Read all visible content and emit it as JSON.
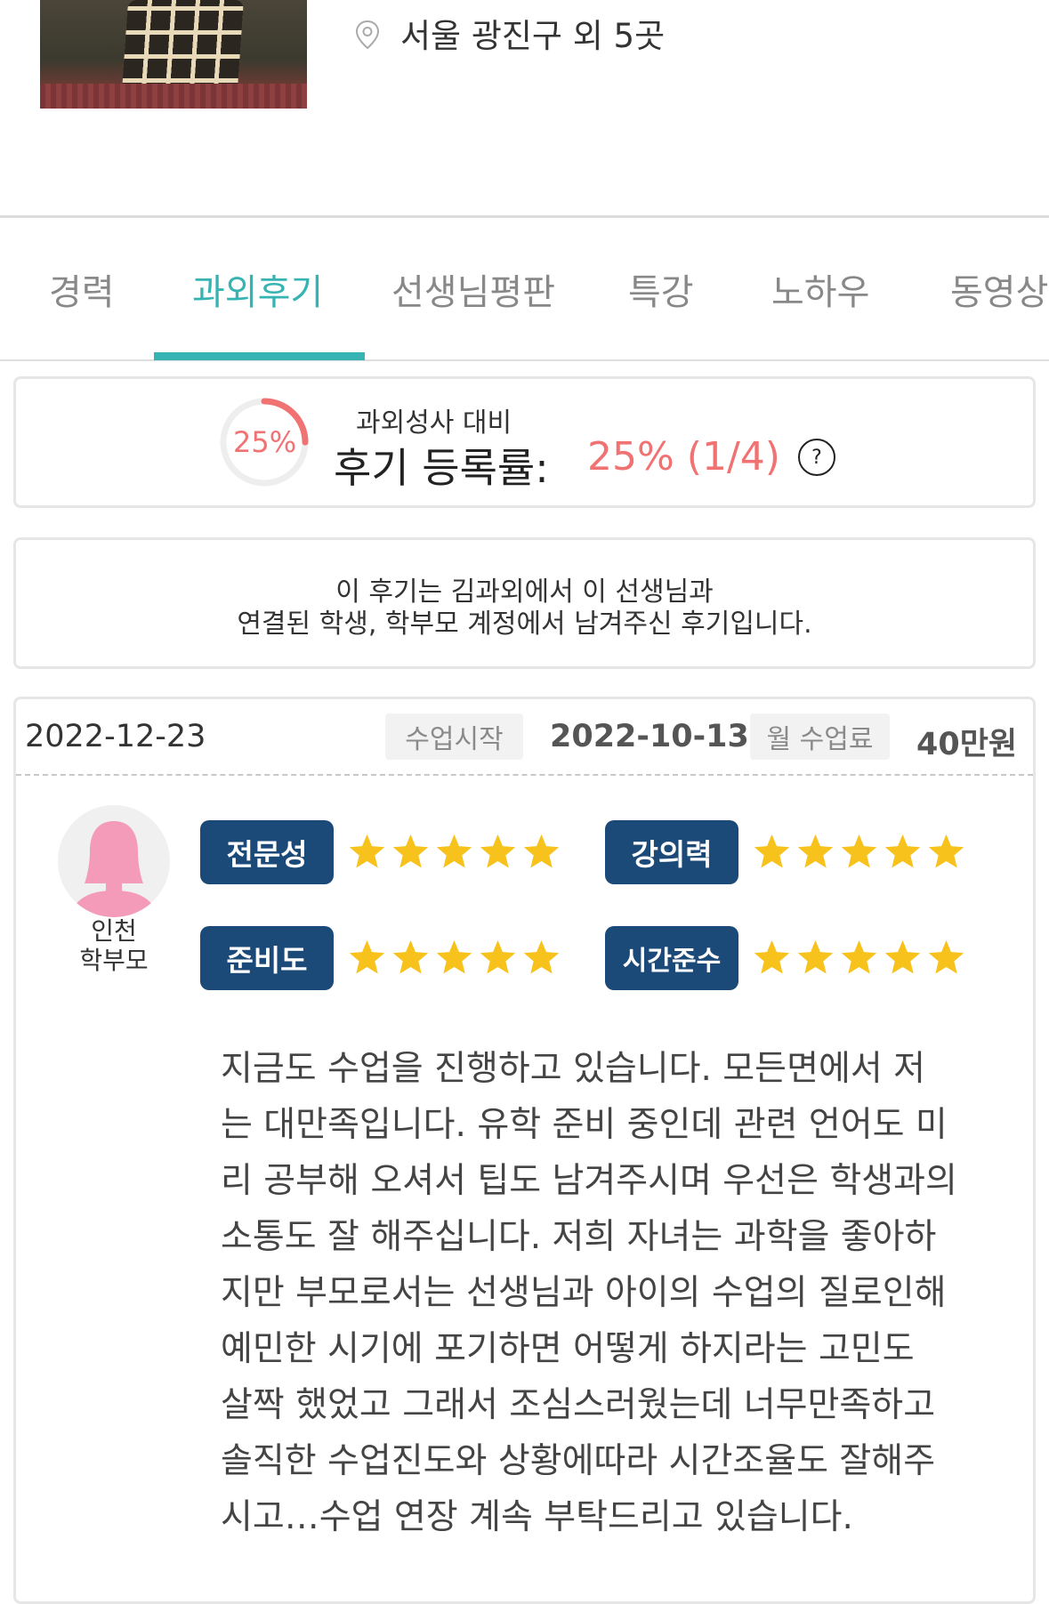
{
  "profile": {
    "location": "서울 광진구 외 5곳"
  },
  "tabs": [
    {
      "label": "경력",
      "active": false
    },
    {
      "label": "과외후기",
      "active": true
    },
    {
      "label": "선생님평판",
      "active": false
    },
    {
      "label": "특강",
      "active": false
    },
    {
      "label": "노하우",
      "active": false
    },
    {
      "label": "동영상",
      "active": false
    }
  ],
  "review_rate": {
    "ring_label": "25%",
    "ring_fraction": 0.25,
    "caption_small": "과외성사 대비",
    "caption_big": "후기 등록률:",
    "value": "25% (1/4)",
    "help_symbol": "?"
  },
  "notice": {
    "line1": "이 후기는 김과외에서 이 선생님과",
    "line2": "연결된 학생, 학부모 계정에서 남겨주신 후기입니다."
  },
  "review": {
    "date": "2022-12-23",
    "start_label": "수업시작",
    "start_date": "2022-10-13",
    "fee_label": "월 수업료",
    "fee_value": "40만원",
    "reviewer": {
      "region": "인천",
      "role": "학부모"
    },
    "ratings": [
      {
        "label": "전문성",
        "stars": 5
      },
      {
        "label": "강의력",
        "stars": 5
      },
      {
        "label": "준비도",
        "stars": 5
      },
      {
        "label": "시간준수",
        "stars": 5
      }
    ],
    "lines": [
      "지금도 수업을 진행하고 있습니다. 모든면에서 저",
      "는 대만족입니다. 유학 준비 중인데 관련 언어도 미",
      "리 공부해 오셔서 팁도 남겨주시며 우선은 학생과의",
      "소통도 잘 해주십니다. 저희 자녀는 과학을 좋아하",
      "지만  부모로서는 선생님과 아이의 수업의 질로인해",
      "예민한  시기에 포기하면 어떻게 하지라는 고민도",
      "살짝 했었고 그래서 조심스러웠는데 너무만족하고",
      "솔직한 수업진도와 상황에따라 시간조율도 잘해주",
      "시고…수업 연장 계속 부탁드리고 있습니다."
    ]
  },
  "colors": {
    "accent": "#36b3b3",
    "rate_red": "#f07272",
    "badge_navy": "#1c4a78",
    "star_yellow": "#f7c21b",
    "avatar_pink": "#f39bb8"
  }
}
